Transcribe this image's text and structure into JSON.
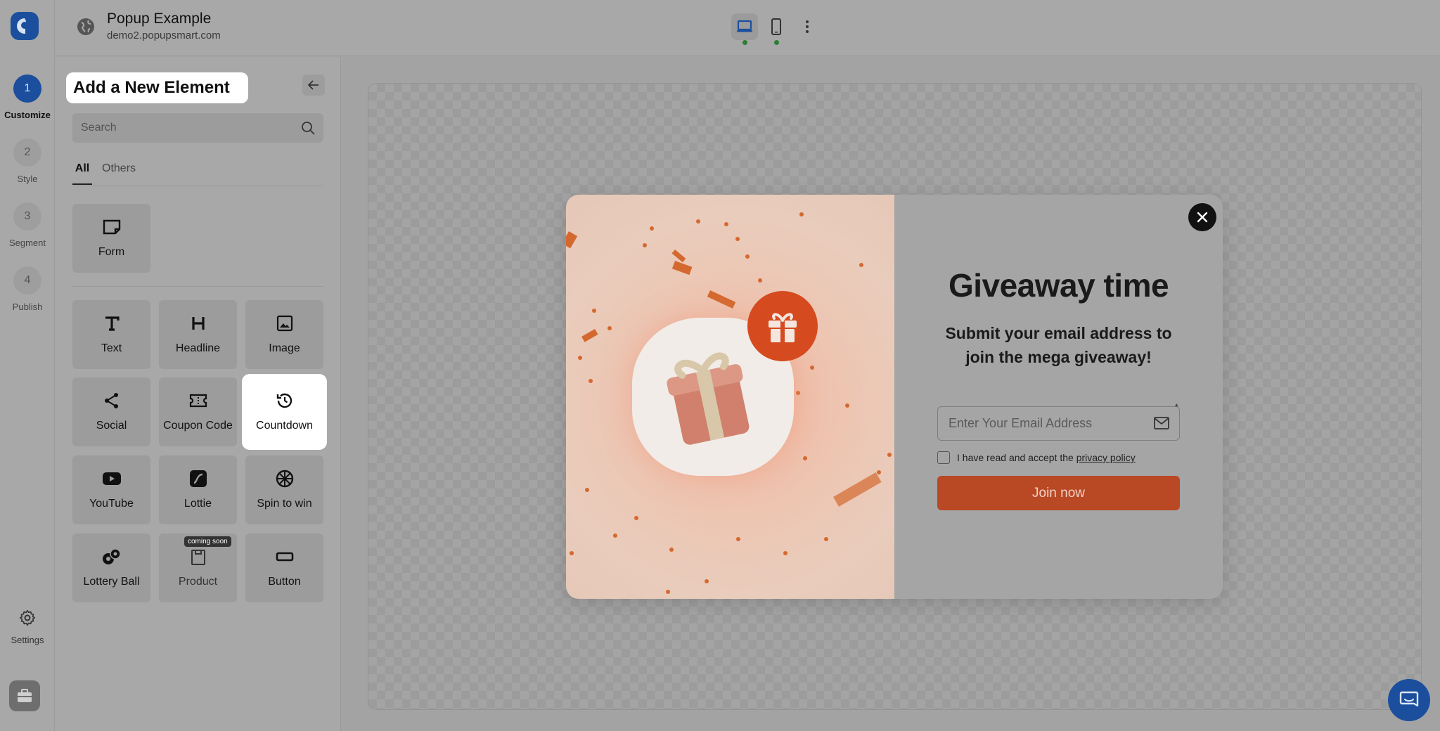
{
  "rail": {
    "steps": [
      {
        "num": "1",
        "label": "Customize"
      },
      {
        "num": "2",
        "label": "Style"
      },
      {
        "num": "3",
        "label": "Segment"
      },
      {
        "num": "4",
        "label": "Publish"
      }
    ],
    "settings_label": "Settings"
  },
  "topbar": {
    "title": "Popup Example",
    "domain": "demo2.popupsmart.com",
    "device_status_color": "#2e7d32"
  },
  "panel": {
    "title": "Add a New Element",
    "search_placeholder": "Search",
    "tabs": [
      {
        "label": "All"
      },
      {
        "label": "Others"
      }
    ],
    "form": {
      "label": "Form",
      "icon": "form-icon"
    },
    "elements": [
      {
        "label": "Text",
        "icon": "text-icon"
      },
      {
        "label": "Headline",
        "icon": "headline-icon"
      },
      {
        "label": "Image",
        "icon": "image-icon"
      },
      {
        "label": "Social",
        "icon": "share-icon"
      },
      {
        "label": "Coupon Code",
        "icon": "coupon-icon"
      },
      {
        "label": "Countdown",
        "icon": "history-icon"
      },
      {
        "label": "YouTube",
        "icon": "youtube-icon"
      },
      {
        "label": "Lottie",
        "icon": "lottie-icon"
      },
      {
        "label": "Spin to win",
        "icon": "wheel-icon"
      },
      {
        "label": "Lottery Ball",
        "icon": "lottery-ball-icon"
      },
      {
        "label": "Product",
        "icon": "product-icon",
        "badge": "coming soon"
      },
      {
        "label": "Button",
        "icon": "button-icon"
      }
    ]
  },
  "popup": {
    "headline": "Giveaway time",
    "subheadline": "Submit your email address to join the mega giveaway!",
    "email_placeholder": "Enter Your Email Address",
    "required_mark": "*",
    "consent_text": "I have read and accept the ",
    "consent_link": "privacy policy",
    "button_label": "Join now",
    "accent_color": "#d54a1e"
  },
  "colors": {
    "brand": "#1b4f9e"
  }
}
